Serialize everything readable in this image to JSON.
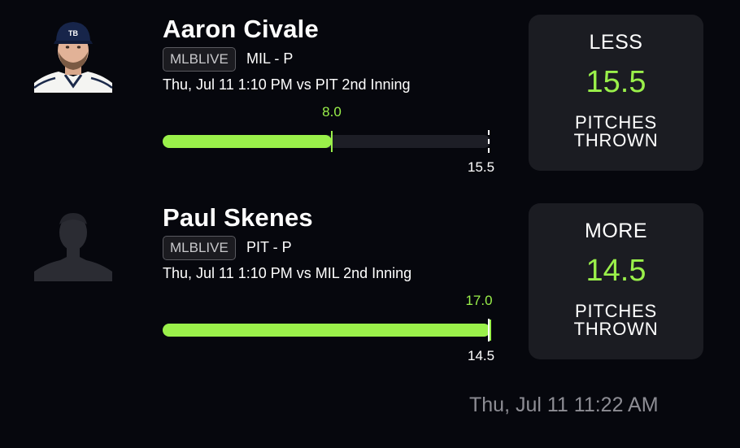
{
  "colors": {
    "background": "#06070d",
    "accent_green": "#9af04a",
    "card_bg": "#1b1c22",
    "track_bg": "#1d1e26",
    "muted_text": "#8d8d94"
  },
  "players": [
    {
      "name": "Aaron Civale",
      "league_badge": "MLBLIVE",
      "team_position": "MIL - P",
      "game_info": "Thu, Jul 11 1:10 PM  vs PIT 2nd Inning",
      "current_value": "8.0",
      "current_value_num": 8.0,
      "line_value": "15.5",
      "line_value_num": 15.5,
      "pick_direction": "LESS",
      "pick_value": "15.5",
      "stat_line1": "PITCHES",
      "stat_line2": "THROWN",
      "avatar_icon": "player-headshot-icon"
    },
    {
      "name": "Paul Skenes",
      "league_badge": "MLBLIVE",
      "team_position": "PIT - P",
      "game_info": "Thu, Jul 11 1:10 PM  vs MIL 2nd Inning",
      "current_value": "17.0",
      "current_value_num": 17.0,
      "line_value": "14.5",
      "line_value_num": 14.5,
      "pick_direction": "MORE",
      "pick_value": "14.5",
      "stat_line1": "PITCHES",
      "stat_line2": "THROWN",
      "avatar_icon": "player-silhouette-icon"
    }
  ],
  "footer": {
    "timestamp": "Thu, Jul 11 11:22 AM"
  }
}
